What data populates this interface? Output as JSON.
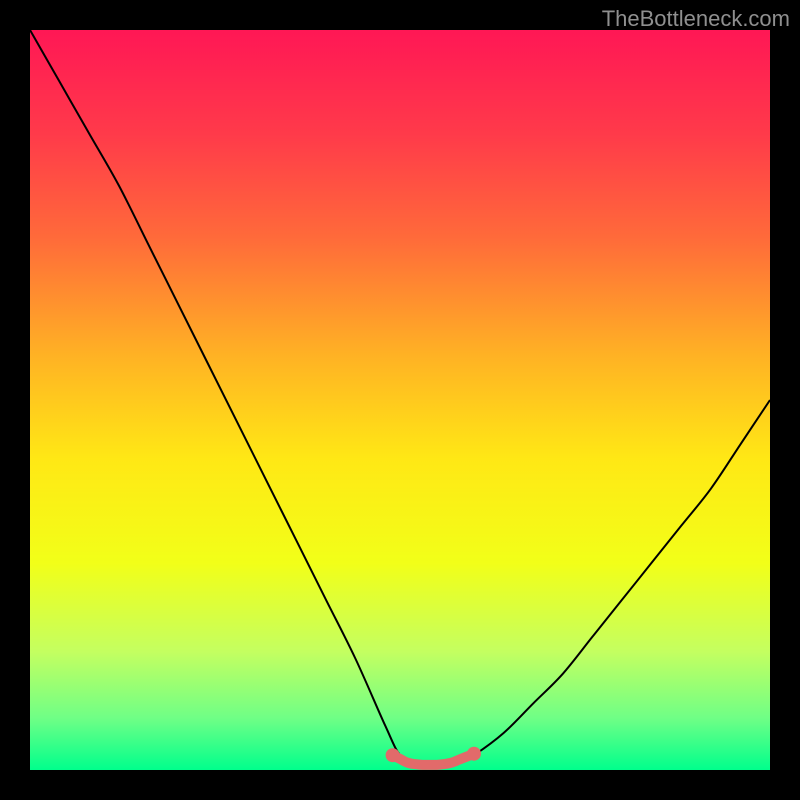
{
  "watermark": "TheBottleneck.com",
  "chart_data": {
    "type": "line",
    "title": "",
    "xlabel": "",
    "ylabel": "",
    "xlim": [
      0,
      100
    ],
    "ylim": [
      0,
      100
    ],
    "background_gradient_stops": [
      {
        "offset": 0.0,
        "color": "#ff1755"
      },
      {
        "offset": 0.14,
        "color": "#ff3a4a"
      },
      {
        "offset": 0.28,
        "color": "#ff6a3a"
      },
      {
        "offset": 0.44,
        "color": "#ffb224"
      },
      {
        "offset": 0.58,
        "color": "#ffe815"
      },
      {
        "offset": 0.72,
        "color": "#f2ff18"
      },
      {
        "offset": 0.84,
        "color": "#c4ff60"
      },
      {
        "offset": 0.93,
        "color": "#6fff86"
      },
      {
        "offset": 1.0,
        "color": "#00ff8c"
      }
    ],
    "series": [
      {
        "name": "curve",
        "color": "#000000",
        "width": 2,
        "x": [
          0,
          4,
          8,
          12,
          16,
          20,
          24,
          28,
          32,
          36,
          40,
          44,
          48,
          50,
          52,
          54,
          56,
          58,
          60,
          64,
          68,
          72,
          76,
          80,
          84,
          88,
          92,
          96,
          100
        ],
        "y": [
          100,
          93,
          86,
          79,
          71,
          63,
          55,
          47,
          39,
          31,
          23,
          15,
          6,
          2,
          1,
          1,
          1,
          1,
          2,
          5,
          9,
          13,
          18,
          23,
          28,
          33,
          38,
          44,
          50
        ]
      },
      {
        "name": "marked-band",
        "color": "#e26a6a",
        "width": 10,
        "linecap": "round",
        "x": [
          49,
          50,
          51,
          52,
          53,
          54,
          55,
          56,
          57,
          58,
          59,
          60
        ],
        "y": [
          2,
          1.5,
          1,
          0.8,
          0.7,
          0.7,
          0.7,
          0.8,
          1,
          1.4,
          1.8,
          2.2
        ]
      }
    ],
    "marker_points": {
      "name": "band-endpoints",
      "color": "#e26a6a",
      "radius": 7,
      "points": [
        {
          "x": 49,
          "y": 2
        },
        {
          "x": 60,
          "y": 2.2
        }
      ]
    }
  }
}
